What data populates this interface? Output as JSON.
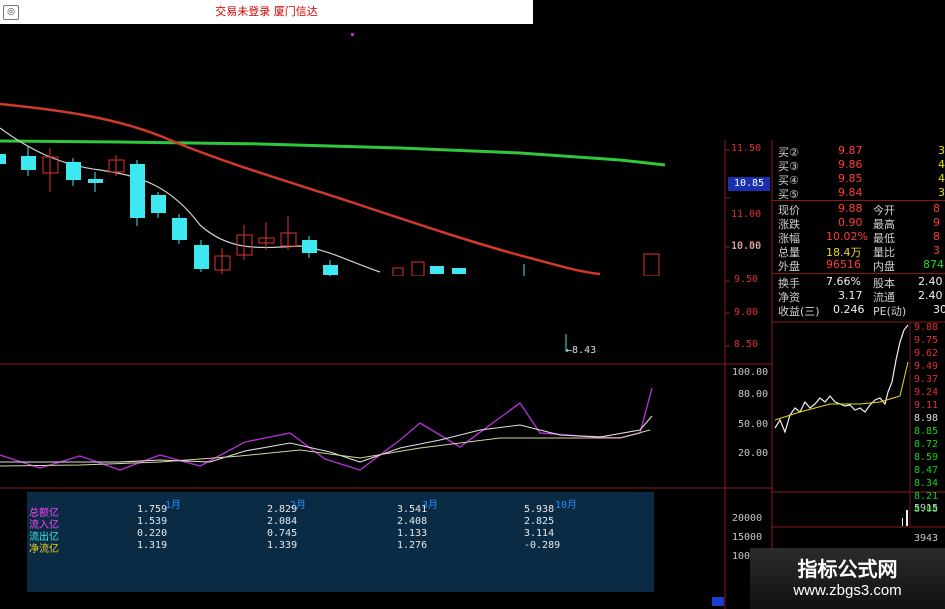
{
  "titlebar": {
    "icon": "tdx-logo-icon",
    "title": "交易未登录 厦门信达"
  },
  "price_axis": {
    "ticks": [
      "11.50",
      "11.00",
      "10.50",
      "10.00",
      "9.50",
      "9.00",
      "8.50"
    ],
    "current_tag": "10.85",
    "low_marker": "8.43"
  },
  "indicator_axis": {
    "ticks": [
      "100.00",
      "80.00",
      "50.00",
      "20.00"
    ]
  },
  "volume_axis": {
    "ticks": [
      "20000",
      "15000",
      "10000"
    ]
  },
  "quote_panel": {
    "bids": [
      {
        "label": "买②",
        "price": "9.87",
        "qty": "3"
      },
      {
        "label": "买③",
        "price": "9.86",
        "qty": "4"
      },
      {
        "label": "买④",
        "price": "9.85",
        "qty": "4"
      },
      {
        "label": "买⑤",
        "price": "9.84",
        "qty": "3"
      }
    ],
    "stats": [
      {
        "l1": "现价",
        "v1": "9.88",
        "l2": "今开",
        "v2": "8"
      },
      {
        "l1": "涨跌",
        "v1": "0.90",
        "l2": "最高",
        "v2": "9"
      },
      {
        "l1": "涨幅",
        "v1": "10.02%",
        "l2": "最低",
        "v2": "8"
      },
      {
        "l1": "总量",
        "v1": "18.4万",
        "l2": "量比",
        "v2": "3"
      },
      {
        "l1": "外盘",
        "v1": "96516",
        "l2": "内盘",
        "v2": "874"
      },
      {
        "l1": "换手",
        "v1": "7.66%",
        "l2": "股本",
        "v2": "2.40"
      },
      {
        "l1": "净资",
        "v1": "3.17",
        "l2": "流通",
        "v2": "2.40"
      },
      {
        "l1": "收益(三)",
        "v1": "0.246",
        "l2": "PE(动)",
        "v2": "30"
      }
    ]
  },
  "intraday_axis": {
    "ticks": [
      "9.88",
      "9.75",
      "9.62",
      "9.49",
      "9.37",
      "9.24",
      "9.11",
      "8.98",
      "8.85",
      "8.72",
      "8.59",
      "8.47",
      "8.34",
      "8.21",
      "8.08"
    ],
    "vol_ticks": [
      "5915",
      "3943"
    ]
  },
  "fund_flow": {
    "labels": [
      "总额亿",
      "流入亿",
      "流出亿",
      "净流亿"
    ],
    "months": [
      "1月",
      "2月",
      "3月",
      "10月"
    ],
    "columns": [
      [
        "1.759",
        "1.539",
        "0.220",
        "1.319"
      ],
      [
        "2.829",
        "2.084",
        "0.745",
        "1.339"
      ],
      [
        "3.541",
        "2.408",
        "1.133",
        "1.276"
      ],
      [
        "5.938",
        "2.825",
        "3.114",
        "-0.289"
      ]
    ]
  },
  "watermark": {
    "line1": "指标公式网",
    "line2": "www.zbgs3.com"
  },
  "colors": {
    "up": "#ff3b3b",
    "down": "#1fdc1f",
    "ma_long": "#2fc83a",
    "ma_mid": "#d03a2a",
    "ma_short": "#cfcfcf",
    "indicator": "#b030d0"
  }
}
